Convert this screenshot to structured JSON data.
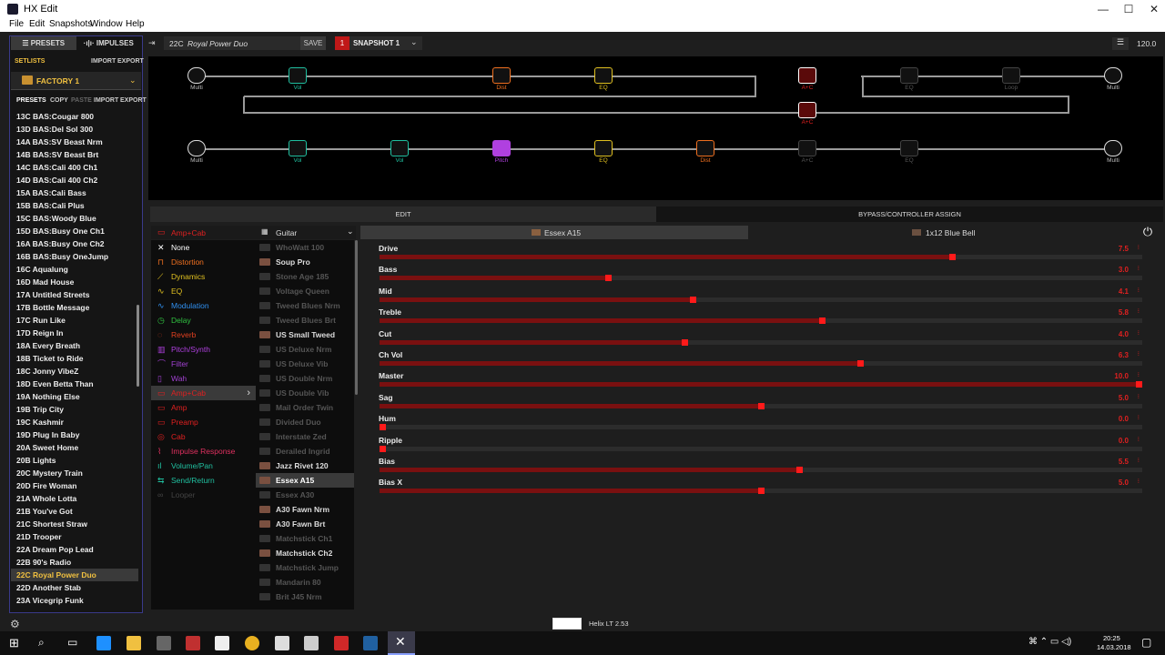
{
  "window": {
    "title": "HX Edit",
    "controls": [
      "—",
      "☐",
      "✕"
    ]
  },
  "menu": [
    "File",
    "Edit",
    "Snapshots",
    "Window",
    "Help"
  ],
  "left": {
    "tab_presets": "PRESETS",
    "tab_impulses": "IMPULSES",
    "setlists": "SETLISTS",
    "setlists_import": "IMPORT",
    "setlists_export": "EXPORT",
    "setlist": "FACTORY 1",
    "presets": "PRESETS",
    "copy": "COPY",
    "paste": "PASTE",
    "import": "IMPORT",
    "export": "EXPORT",
    "items": [
      "13C BAS:Cougar 800",
      "13D BAS:Del Sol 300",
      "14A BAS:SV Beast Nrm",
      "14B BAS:SV Beast Brt",
      "14C BAS:Cali 400 Ch1",
      "14D BAS:Cali 400 Ch2",
      "15A BAS:Cali Bass",
      "15B BAS:Cali Plus",
      "15C BAS:Woody Blue",
      "15D BAS:Busy One Ch1",
      "16A BAS:Busy One Ch2",
      "16B BAS:Busy OneJump",
      "16C Aqualung",
      "16D Mad House",
      "17A Untitled Streets",
      "17B Bottle Message",
      "17C Run Like",
      "17D Reign In",
      "18A Every Breath",
      "18B Ticket to Ride",
      "18C Jonny VibeZ",
      "18D Even Betta Than",
      "19A Nothing Else",
      "19B Trip City",
      "19C Kashmir",
      "19D Plug In Baby",
      "20A Sweet Home",
      "20B Lights",
      "20C Mystery Train",
      "20D Fire Woman",
      "21A Whole Lotta",
      "21B You've Got",
      "21C Shortest Straw",
      "21D Trooper",
      "22A Dream Pop Lead",
      "22B 90's Radio",
      "22C Royal Power Duo",
      "22D Another Stab",
      "23A Vicegrip Funk"
    ],
    "selected_index": 36
  },
  "toolbar": {
    "preset_id": "22C",
    "preset_name": "Royal Power Duo",
    "save": "SAVE",
    "snapshot_num": "1",
    "snapshot": "SNAPSHOT 1",
    "tempo": "120.0"
  },
  "path1": {
    "blocks": [
      {
        "label": "Multi",
        "type": "io"
      },
      {
        "label": "Vol",
        "type": "vol"
      },
      {
        "label": "Dist",
        "type": "dist"
      },
      {
        "label": "EQ",
        "type": "eq"
      },
      {
        "label": "A+C",
        "type": "amp"
      },
      {
        "label": "EQ",
        "type": "eq"
      },
      {
        "label": "Loop",
        "type": "loop"
      },
      {
        "label": "Multi",
        "type": "io"
      }
    ],
    "mid_block": "A+C"
  },
  "path2": {
    "blocks": [
      {
        "label": "Multi",
        "type": "io"
      },
      {
        "label": "Vol",
        "type": "vol"
      },
      {
        "label": "Vol",
        "type": "vol"
      },
      {
        "label": "Pitch",
        "type": "pitch"
      },
      {
        "label": "EQ",
        "type": "eq"
      },
      {
        "label": "Dist",
        "type": "dist"
      },
      {
        "label": "A+C",
        "type": "amp"
      },
      {
        "label": "EQ",
        "type": "eq"
      },
      {
        "label": "Multi",
        "type": "io"
      }
    ]
  },
  "edit_tab": "EDIT",
  "bypass_tab": "BYPASS/CONTROLLER ASSIGN",
  "category_header": "Amp+Cab",
  "subcategory": "Guitar",
  "categories": [
    {
      "label": "None",
      "color": "#ffffff",
      "icon": "✕"
    },
    {
      "label": "Distortion",
      "color": "#f07020",
      "icon": "⊓"
    },
    {
      "label": "Dynamics",
      "color": "#e0c020",
      "icon": "⟋"
    },
    {
      "label": "EQ",
      "color": "#e0c020",
      "icon": "∿"
    },
    {
      "label": "Modulation",
      "color": "#3090f0",
      "icon": "∿"
    },
    {
      "label": "Delay",
      "color": "#30c040",
      "icon": "◷"
    },
    {
      "label": "Reverb",
      "color": "#e04020",
      "icon": "◌"
    },
    {
      "label": "Pitch/Synth",
      "color": "#b040e0",
      "icon": "▥"
    },
    {
      "label": "Filter",
      "color": "#a040d0",
      "icon": "⌒"
    },
    {
      "label": "Wah",
      "color": "#a040d0",
      "icon": "▯"
    },
    {
      "label": "Amp+Cab",
      "color": "#e02020",
      "icon": "▭"
    },
    {
      "label": "Amp",
      "color": "#e02020",
      "icon": "▭"
    },
    {
      "label": "Preamp",
      "color": "#e02020",
      "icon": "▭"
    },
    {
      "label": "Cab",
      "color": "#e02020",
      "icon": "◎"
    },
    {
      "label": "Impulse Response",
      "color": "#e03060",
      "icon": "⌇"
    },
    {
      "label": "Volume/Pan",
      "color": "#20c0a0",
      "icon": "ıl"
    },
    {
      "label": "Send/Return",
      "color": "#20c0a0",
      "icon": "⇆"
    },
    {
      "label": "Looper",
      "color": "#444444",
      "icon": "∞"
    }
  ],
  "models": [
    {
      "label": "WhoWatt 100",
      "state": "off"
    },
    {
      "label": "Soup Pro",
      "state": "on"
    },
    {
      "label": "Stone Age 185",
      "state": "off"
    },
    {
      "label": "Voltage Queen",
      "state": "off"
    },
    {
      "label": "Tweed Blues Nrm",
      "state": "off"
    },
    {
      "label": "Tweed Blues Brt",
      "state": "off"
    },
    {
      "label": "US Small Tweed",
      "state": "on"
    },
    {
      "label": "US Deluxe Nrm",
      "state": "off"
    },
    {
      "label": "US Deluxe Vib",
      "state": "off"
    },
    {
      "label": "US Double Nrm",
      "state": "off"
    },
    {
      "label": "US Double Vib",
      "state": "off"
    },
    {
      "label": "Mail Order Twin",
      "state": "off"
    },
    {
      "label": "Divided Duo",
      "state": "off"
    },
    {
      "label": "Interstate Zed",
      "state": "off"
    },
    {
      "label": "Derailed Ingrid",
      "state": "off"
    },
    {
      "label": "Jazz Rivet 120",
      "state": "on"
    },
    {
      "label": "Essex A15",
      "state": "sel"
    },
    {
      "label": "Essex A30",
      "state": "off"
    },
    {
      "label": "A30 Fawn Nrm",
      "state": "on"
    },
    {
      "label": "A30 Fawn Brt",
      "state": "on"
    },
    {
      "label": "Matchstick Ch1",
      "state": "off"
    },
    {
      "label": "Matchstick Ch2",
      "state": "on"
    },
    {
      "label": "Matchstick Jump",
      "state": "off"
    },
    {
      "label": "Mandarin 80",
      "state": "off"
    },
    {
      "label": "Brit J45 Nrm",
      "state": "off"
    }
  ],
  "amp_tab": "Essex A15",
  "cab_tab": "1x12 Blue Bell",
  "parameters": [
    {
      "name": "Drive",
      "value": "7.5",
      "frac": 0.75
    },
    {
      "name": "Bass",
      "value": "3.0",
      "frac": 0.3
    },
    {
      "name": "Mid",
      "value": "4.1",
      "frac": 0.41
    },
    {
      "name": "Treble",
      "value": "5.8",
      "frac": 0.58
    },
    {
      "name": "Cut",
      "value": "4.0",
      "frac": 0.4
    },
    {
      "name": "Ch Vol",
      "value": "6.3",
      "frac": 0.63
    },
    {
      "name": "Master",
      "value": "10.0",
      "frac": 1.0
    },
    {
      "name": "Sag",
      "value": "5.0",
      "frac": 0.5
    },
    {
      "name": "Hum",
      "value": "0.0",
      "frac": 0.0
    },
    {
      "name": "Ripple",
      "value": "0.0",
      "frac": 0.0
    },
    {
      "name": "Bias",
      "value": "5.5",
      "frac": 0.55
    },
    {
      "name": "Bias X",
      "value": "5.0",
      "frac": 0.5
    }
  ],
  "status": "Helix LT 2.53",
  "taskbar": {
    "time": "20:25",
    "date": "14.03.2018"
  }
}
